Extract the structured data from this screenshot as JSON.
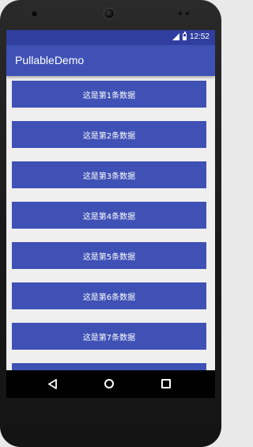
{
  "status_bar": {
    "time": "12:52",
    "icons": [
      "signal-icon",
      "battery-icon"
    ]
  },
  "app_bar": {
    "title": "PullableDemo"
  },
  "list": {
    "items": [
      "这是第1条数据",
      "这是第2条数据",
      "这是第3条数据",
      "这是第4条数据",
      "这是第5条数据",
      "这是第6条数据",
      "这是第7条数据",
      ""
    ]
  },
  "nav_bar": {
    "buttons": [
      "back-icon",
      "home-icon",
      "recent-apps-icon"
    ]
  },
  "colors": {
    "primary": "#3f51b5",
    "primary_dark": "#303f9f",
    "background": "#efefef"
  }
}
